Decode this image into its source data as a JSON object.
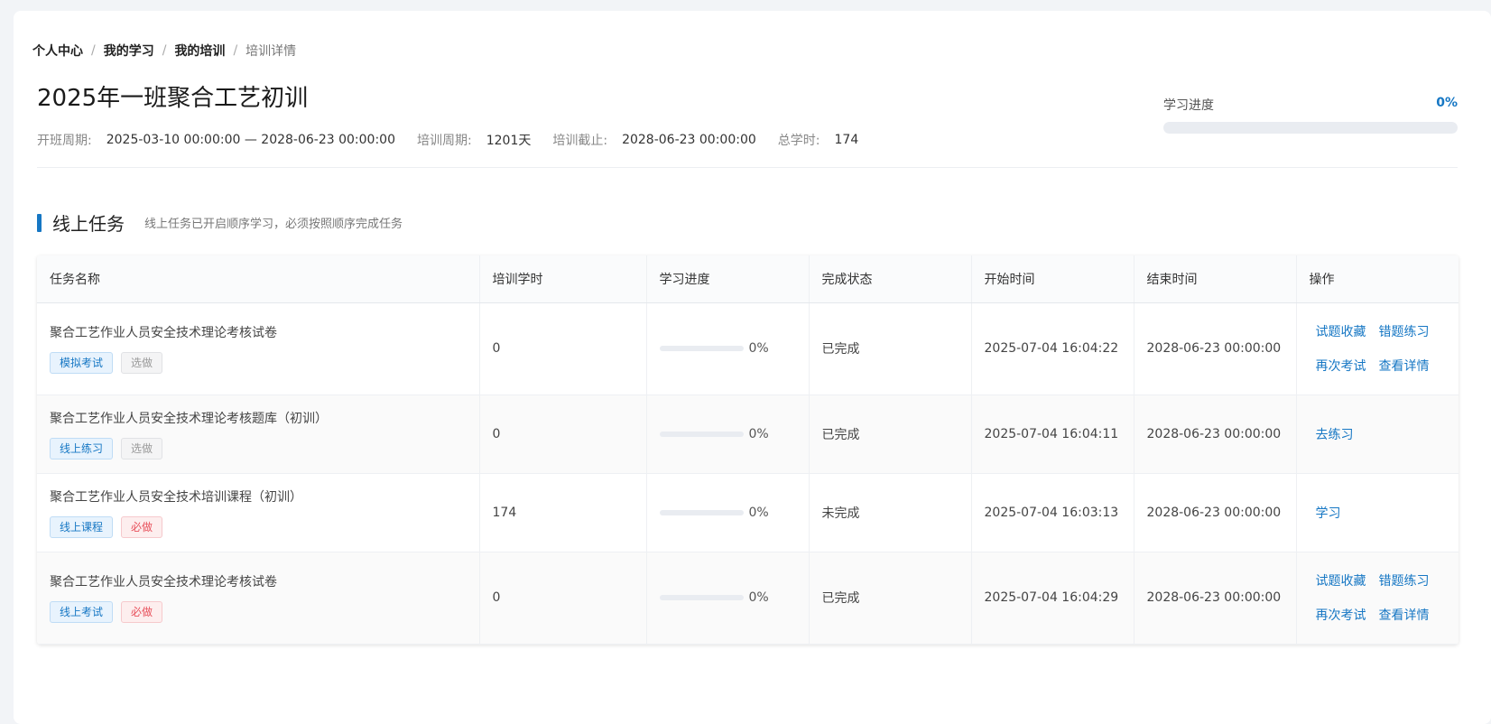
{
  "breadcrumb": [
    {
      "label": "个人中心"
    },
    {
      "label": "我的学习"
    },
    {
      "label": "我的培训"
    },
    {
      "label": "培训详情"
    }
  ],
  "header": {
    "title": "2025年一班聚合工艺初训",
    "meta": [
      {
        "key": "开班周期:",
        "value": "2025-03-10 00:00:00 — 2028-06-23 00:00:00"
      },
      {
        "key": "培训周期:",
        "value": "1201天"
      },
      {
        "key": "培训截止:",
        "value": "2028-06-23 00:00:00"
      },
      {
        "key": "总学时:",
        "value": "174"
      }
    ],
    "progress": {
      "label": "学习进度",
      "percent_text": "0%",
      "percent": 0
    }
  },
  "section": {
    "title": "线上任务",
    "note": "线上任务已开启顺序学习，必须按照顺序完成任务"
  },
  "table": {
    "headers": [
      "任务名称",
      "培训学时",
      "学习进度",
      "完成状态",
      "开始时间",
      "结束时间",
      "操作"
    ],
    "rows": [
      {
        "name": "聚合工艺作业人员安全技术理论考核试卷",
        "tags": [
          {
            "text": "模拟考试",
            "style": "blue"
          },
          {
            "text": "选做",
            "style": "gray"
          }
        ],
        "hours": "0",
        "progress": 0,
        "progress_text": "0%",
        "status": "已完成",
        "start": "2025-07-04 16:04:22",
        "end": "2028-06-23 00:00:00",
        "actions": [
          "试题收藏",
          "错题练习",
          "再次考试",
          "查看详情"
        ]
      },
      {
        "name": "聚合工艺作业人员安全技术理论考核题库（初训）",
        "tags": [
          {
            "text": "线上练习",
            "style": "blue"
          },
          {
            "text": "选做",
            "style": "gray"
          }
        ],
        "hours": "0",
        "progress": 0,
        "progress_text": "0%",
        "status": "已完成",
        "start": "2025-07-04 16:04:11",
        "end": "2028-06-23 00:00:00",
        "actions": [
          "去练习"
        ]
      },
      {
        "name": "聚合工艺作业人员安全技术培训课程（初训）",
        "tags": [
          {
            "text": "线上课程",
            "style": "blue"
          },
          {
            "text": "必做",
            "style": "red"
          }
        ],
        "hours": "174",
        "progress": 0,
        "progress_text": "0%",
        "status": "未完成",
        "start": "2025-07-04 16:03:13",
        "end": "2028-06-23 00:00:00",
        "actions": [
          "学习"
        ]
      },
      {
        "name": "聚合工艺作业人员安全技术理论考核试卷",
        "tags": [
          {
            "text": "线上考试",
            "style": "blue"
          },
          {
            "text": "必做",
            "style": "red"
          }
        ],
        "hours": "0",
        "progress": 0,
        "progress_text": "0%",
        "status": "已完成",
        "start": "2025-07-04 16:04:29",
        "end": "2028-06-23 00:00:00",
        "actions": [
          "试题收藏",
          "错题练习",
          "再次考试",
          "查看详情"
        ]
      }
    ]
  },
  "colors": {
    "accent": "#1677c4",
    "required": "#e8505b"
  }
}
